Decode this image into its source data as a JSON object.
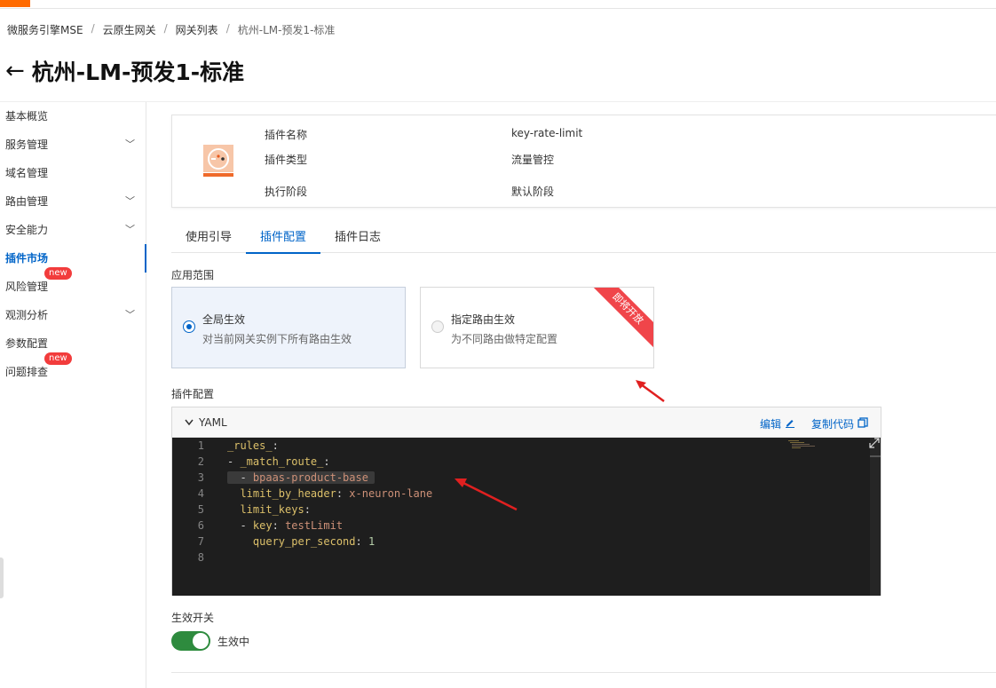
{
  "breadcrumb": {
    "item1": "微服务引擎MSE",
    "item2": "云原生网关",
    "item3": "网关列表",
    "current": "杭州-LM-预发1-标准",
    "sep": "/"
  },
  "page": {
    "back_glyph": "←",
    "title": "杭州-LM-预发1-标准"
  },
  "sidebar": {
    "items": [
      {
        "label": "基本概览",
        "chevron": ""
      },
      {
        "label": "服务管理",
        "chevron": "﹀"
      },
      {
        "label": "域名管理",
        "chevron": ""
      },
      {
        "label": "路由管理",
        "chevron": "﹀"
      },
      {
        "label": "安全能力",
        "chevron": "﹀"
      },
      {
        "label": "插件市场",
        "chevron": ""
      },
      {
        "label": "风险管理",
        "chevron": "",
        "badge": "new"
      },
      {
        "label": "观测分析",
        "chevron": "﹀"
      },
      {
        "label": "参数配置",
        "chevron": ""
      },
      {
        "label": "问题排查",
        "chevron": "",
        "badge": "new"
      }
    ]
  },
  "plugin": {
    "name_label": "插件名称",
    "name_value": "key-rate-limit",
    "type_label": "插件类型",
    "type_value": "流量管控",
    "stage_label": "执行阶段",
    "stage_value": "默认阶段"
  },
  "tabs": [
    "使用引导",
    "插件配置",
    "插件日志"
  ],
  "scope": {
    "label": "应用范围",
    "global_title": "全局生效",
    "global_desc": "对当前网关实例下所有路由生效",
    "route_title": "指定路由生效",
    "route_desc": "为不同路由做特定配置",
    "ribbon": "即将开放"
  },
  "config": {
    "label": "插件配置",
    "lang": "YAML",
    "edit": "编辑",
    "copy": "复制代码",
    "lines": [
      {
        "n": "1"
      },
      {
        "n": "2"
      },
      {
        "n": "3"
      },
      {
        "n": "4"
      },
      {
        "n": "5"
      },
      {
        "n": "6"
      },
      {
        "n": "7"
      },
      {
        "n": "8"
      }
    ],
    "tokens": {
      "rules": "_rules_",
      "colon": ":",
      "dash": "- ",
      "match_route": "_match_route_",
      "route_value": "bpaas-product-base",
      "limit_by_header": "limit_by_header",
      "header_value": "x-neuron-lane",
      "limit_keys": "limit_keys",
      "key": "key",
      "key_value": "testLimit",
      "qps": "query_per_second",
      "qps_value": "1"
    }
  },
  "switch": {
    "label": "生效开关",
    "state": "生效中"
  },
  "colors": {
    "accent": "#0064c8",
    "badge": "#f23c3c",
    "toggle": "#2e8b3e",
    "annotation": "#e02020"
  }
}
